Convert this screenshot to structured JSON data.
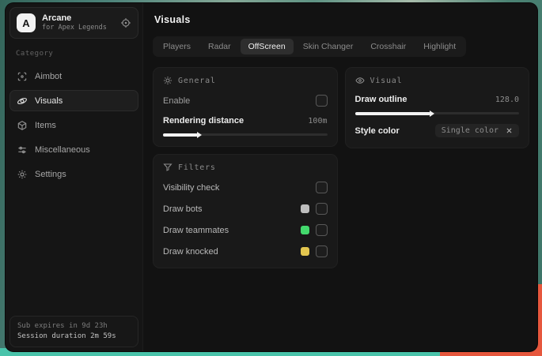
{
  "app": {
    "logo_letter": "A",
    "name": "Arcane",
    "subtitle": "for Apex Legends"
  },
  "sidebar": {
    "category_label": "Category",
    "items": [
      {
        "label": "Aimbot"
      },
      {
        "label": "Visuals"
      },
      {
        "label": "Items"
      },
      {
        "label": "Miscellaneous"
      },
      {
        "label": "Settings"
      }
    ],
    "session": {
      "line1": "Sub expires in 9d 23h",
      "line2": "Session duration 2m 59s"
    }
  },
  "main": {
    "title": "Visuals",
    "tabs": [
      {
        "label": "Players"
      },
      {
        "label": "Radar"
      },
      {
        "label": "OffScreen",
        "active": true
      },
      {
        "label": "Skin Changer"
      },
      {
        "label": "Crosshair"
      },
      {
        "label": "Highlight"
      }
    ],
    "general": {
      "title": "General",
      "enable_label": "Enable",
      "enable_checked": false,
      "distance_label": "Rendering distance",
      "distance_value": "100m",
      "distance_percent": "21%"
    },
    "visual": {
      "title": "Visual",
      "outline_label": "Draw outline",
      "outline_value": "128.0",
      "outline_percent": "46%",
      "style_color_label": "Style color",
      "style_color_value": "Single color"
    },
    "filters": {
      "title": "Filters",
      "rows": [
        {
          "label": "Visibility check"
        },
        {
          "label": "Draw bots",
          "swatch": "#bdbdbd"
        },
        {
          "label": "Draw teammates",
          "swatch": "#43d96d"
        },
        {
          "label": "Draw knocked",
          "swatch": "#e3c64f"
        }
      ]
    }
  },
  "colors": {
    "accent_teal": "#49c3aa",
    "accent_orange": "#e6573d",
    "window_bg": "#121212",
    "card_bg": "#191919"
  }
}
